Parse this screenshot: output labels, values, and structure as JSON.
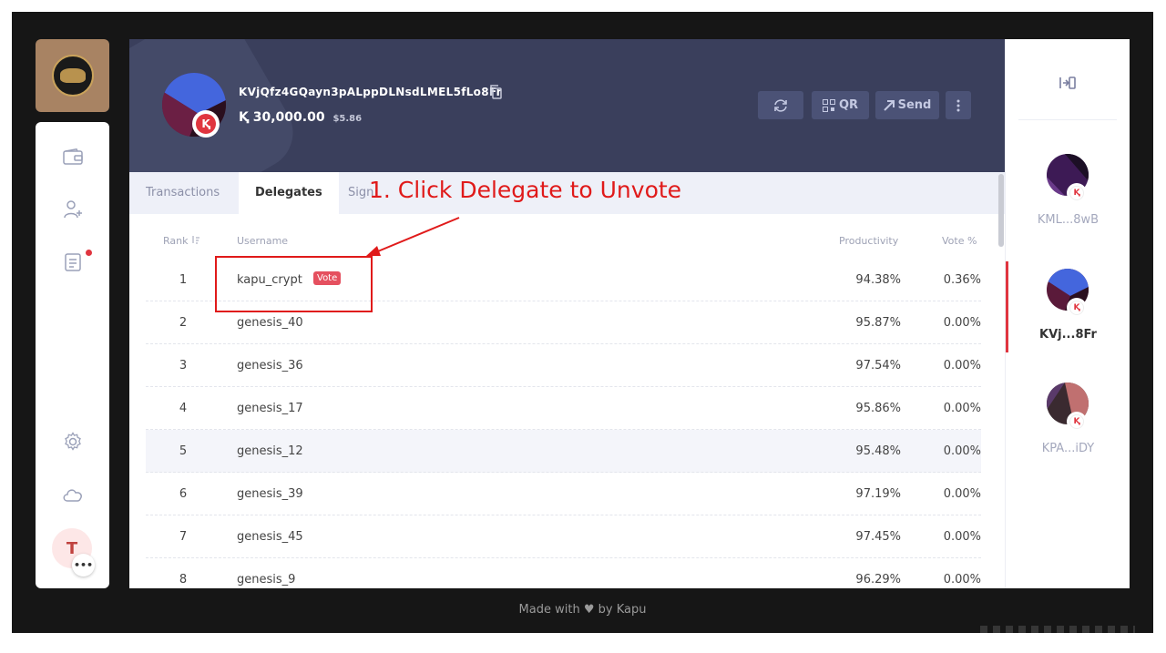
{
  "wallet": {
    "address": "KVjQfz4GQayn3pALppDLNsdLMEL5fLo8Fr",
    "balance": "30,000.00",
    "currency_symbol": "Ⱪ",
    "fiat": "$5.86",
    "badge_letter": "Ⱪ"
  },
  "header_buttons": {
    "qr_label": "QR",
    "send_label": "Send"
  },
  "tabs": [
    {
      "label": "Transactions"
    },
    {
      "label": "Delegates"
    },
    {
      "label": "Sign"
    }
  ],
  "table": {
    "headers": {
      "rank": "Rank",
      "username": "Username",
      "productivity": "Productivity",
      "vote": "Vote %"
    },
    "vote_badge": "Vote",
    "rows": [
      {
        "rank": "1",
        "username": "kapu_crypt",
        "productivity": "94.38%",
        "vote": "0.36%"
      },
      {
        "rank": "2",
        "username": "genesis_40",
        "productivity": "95.87%",
        "vote": "0.00%"
      },
      {
        "rank": "3",
        "username": "genesis_36",
        "productivity": "97.54%",
        "vote": "0.00%"
      },
      {
        "rank": "4",
        "username": "genesis_17",
        "productivity": "95.86%",
        "vote": "0.00%"
      },
      {
        "rank": "5",
        "username": "genesis_12",
        "productivity": "95.48%",
        "vote": "0.00%"
      },
      {
        "rank": "6",
        "username": "genesis_39",
        "productivity": "97.19%",
        "vote": "0.00%"
      },
      {
        "rank": "7",
        "username": "genesis_45",
        "productivity": "97.45%",
        "vote": "0.00%"
      },
      {
        "rank": "8",
        "username": "genesis_9",
        "productivity": "96.29%",
        "vote": "0.00%"
      }
    ]
  },
  "annotation": {
    "text": "1. Click Delegate to Unvote",
    "color": "#e01a1a"
  },
  "sidebar": {
    "avatar_letter": "T",
    "more": "•••"
  },
  "accounts": [
    {
      "name": "KML...8wB"
    },
    {
      "name": "KVj...8Fr"
    },
    {
      "name": "KPA...iDY"
    }
  ],
  "footer": "Made with ♥ by Kapu",
  "colors": {
    "header": "#3a3f5c",
    "accent": "#e0353f",
    "button": "#4b5276"
  }
}
